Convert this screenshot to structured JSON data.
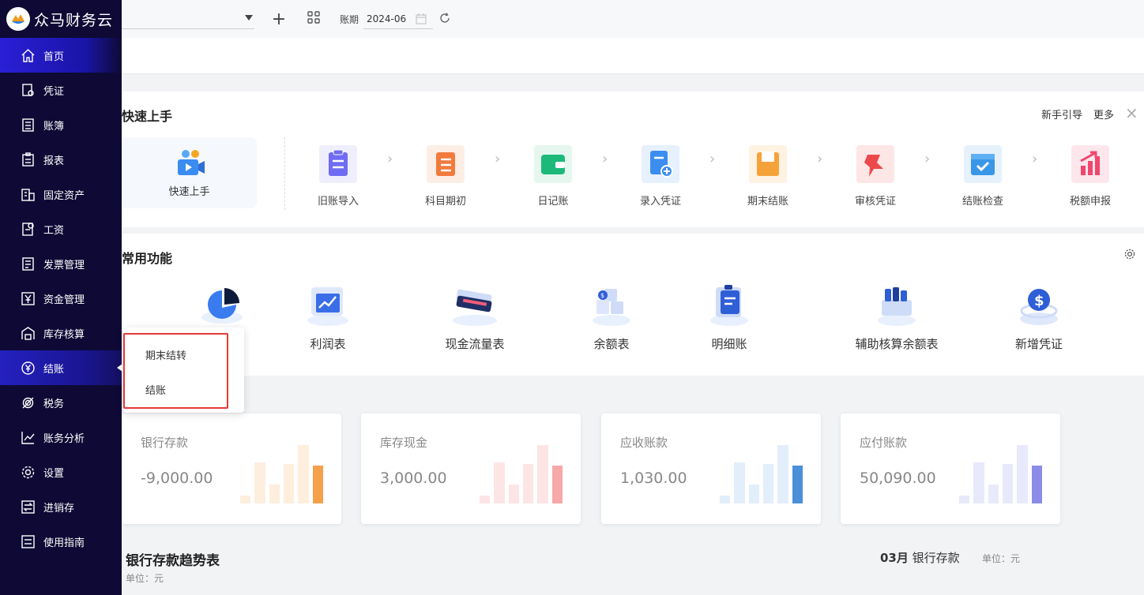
{
  "app": {
    "name": "众马财务云"
  },
  "sidebar": {
    "items": [
      {
        "label": "首页",
        "icon": "home-icon"
      },
      {
        "label": "凭证",
        "icon": "voucher-icon"
      },
      {
        "label": "账簿",
        "icon": "ledger-icon"
      },
      {
        "label": "报表",
        "icon": "report-icon"
      },
      {
        "label": "固定资产",
        "icon": "building-icon"
      },
      {
        "label": "工资",
        "icon": "salary-icon"
      },
      {
        "label": "发票管理",
        "icon": "invoice-icon"
      },
      {
        "label": "资金管理",
        "icon": "yen-icon"
      },
      {
        "label": "库存核算",
        "icon": "warehouse-icon"
      },
      {
        "label": "结账",
        "icon": "yen-circle-icon"
      },
      {
        "label": "税务",
        "icon": "tax-icon"
      },
      {
        "label": "账务分析",
        "icon": "line-chart-icon"
      },
      {
        "label": "设置",
        "icon": "gear-icon"
      },
      {
        "label": "进销存",
        "icon": "exchange-icon"
      },
      {
        "label": "使用指南",
        "icon": "guide-icon"
      }
    ],
    "active_index": 0,
    "hover_index": 9
  },
  "topbar": {
    "period_label": "账期",
    "period_value": "2024-06"
  },
  "quick_start": {
    "title": "快速上手",
    "guide_link": "新手引导",
    "more_link": "更多",
    "hero_label": "快速上手",
    "steps": [
      {
        "label": "旧账导入",
        "icon": "clipboard-icon",
        "color": "#6f6cf3"
      },
      {
        "label": "科目期初",
        "icon": "list-icon",
        "color": "#f27a3c"
      },
      {
        "label": "日记账",
        "icon": "wallet-icon",
        "color": "#1cb97a"
      },
      {
        "label": "录入凭证",
        "icon": "doc-add-icon",
        "color": "#3c8df0"
      },
      {
        "label": "期末结账",
        "icon": "folder-icon",
        "color": "#f6a23a"
      },
      {
        "label": "审核凭证",
        "icon": "pin-icon",
        "color": "#ec4a4a"
      },
      {
        "label": "结账检查",
        "icon": "calendar-check-icon",
        "color": "#3a97e8"
      },
      {
        "label": "税额申报",
        "icon": "bar-chart-icon",
        "color": "#ef476f"
      }
    ]
  },
  "common_functions": {
    "title": "常用功能",
    "items": [
      {
        "label": "利润表",
        "icon": "profit-chart-icon"
      },
      {
        "label": "现金流量表",
        "icon": "cash-stack-icon"
      },
      {
        "label": "余额表",
        "icon": "balance-cubes-icon"
      },
      {
        "label": "明细账",
        "icon": "detail-clipboard-icon"
      },
      {
        "label": "辅助核算余额表",
        "icon": "aux-box-icon"
      },
      {
        "label": "新增凭证",
        "icon": "dollar-coin-icon"
      }
    ]
  },
  "popup": {
    "items": [
      "期末结转",
      "结账"
    ]
  },
  "stats": [
    {
      "title": "银行存款",
      "value": "-9,000.00",
      "color": "#f5a04a",
      "light": "#fdeede"
    },
    {
      "title": "库存现金",
      "value": "3,000.00",
      "color": "#f7a8a8",
      "light": "#fde5e5"
    },
    {
      "title": "应收账款",
      "value": "1,030.00",
      "color": "#4a8fd8",
      "light": "#e3eefb"
    },
    {
      "title": "应付账款",
      "value": "50,090.00",
      "color": "#8a8ce8",
      "light": "#e8e9fb"
    }
  ],
  "trend": {
    "title": "银行存款趋势表",
    "unit": "单位：元",
    "right_month": "03月",
    "right_label": "银行存款",
    "right_unit": "单位：元"
  }
}
